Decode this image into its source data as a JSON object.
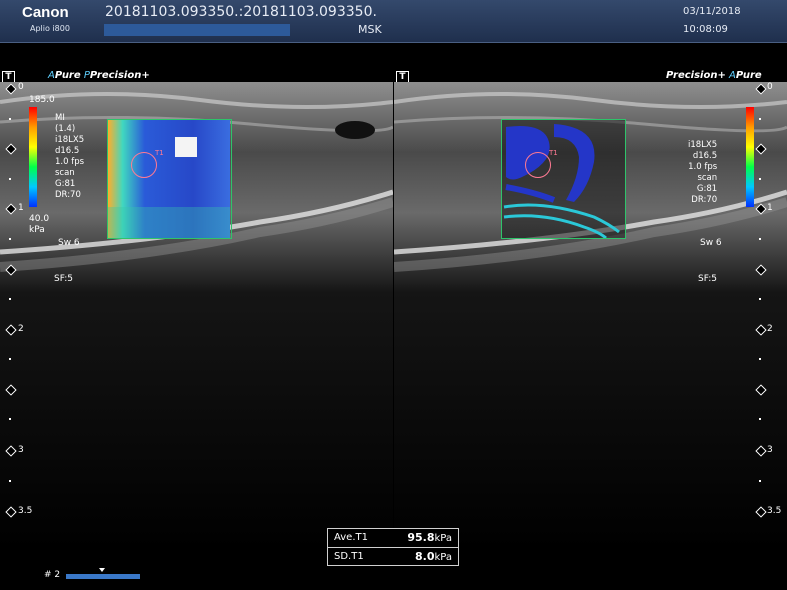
{
  "header": {
    "brand": "Canon",
    "model": "Aplio i800",
    "patient_id": "20181103.093350.:20181103.093350.",
    "preset": "MSK",
    "date": "03/11/2018",
    "time": "10:08:09"
  },
  "left_image": {
    "probe_label": "Pure",
    "probe_prefix": "A",
    "precision_label": "Precision",
    "precision_prefix": "P",
    "plus": "+",
    "scale_max": "185.0",
    "scale_min": "40.0",
    "scale_unit": "kPa",
    "params": [
      "MI",
      "(1.4)",
      "i18LX5",
      "d16.5",
      "1.0 fps",
      "scan",
      "G:81",
      "DR:70"
    ],
    "sw": "Sw 6",
    "sf": "SF:5",
    "roi_label": "T1"
  },
  "right_image": {
    "precision_label": "Precision",
    "plus": "+",
    "probe_prefix": "A",
    "probe_label": "Pure",
    "params": [
      "i18LX5",
      "d16.5",
      "1.0 fps",
      "scan",
      "G:81",
      "DR:70"
    ],
    "sw": "Sw 6",
    "sf": "SF:5",
    "roi_label": "T1"
  },
  "depth_marks": [
    "0",
    "1",
    "2",
    "3",
    "3.5"
  ],
  "measurement": {
    "ave_label": "Ave.T1",
    "ave_value": "95.8",
    "ave_unit": "kPa",
    "sd_label": "SD.T1",
    "sd_value": "8.0",
    "sd_unit": "kPa"
  },
  "frame_label": "# 2",
  "colors": {
    "header_bg": "#2a3d5f",
    "accent": "#5fd0ff",
    "roi_border": "#2ec46a",
    "roi_circle": "#ff7a93"
  }
}
